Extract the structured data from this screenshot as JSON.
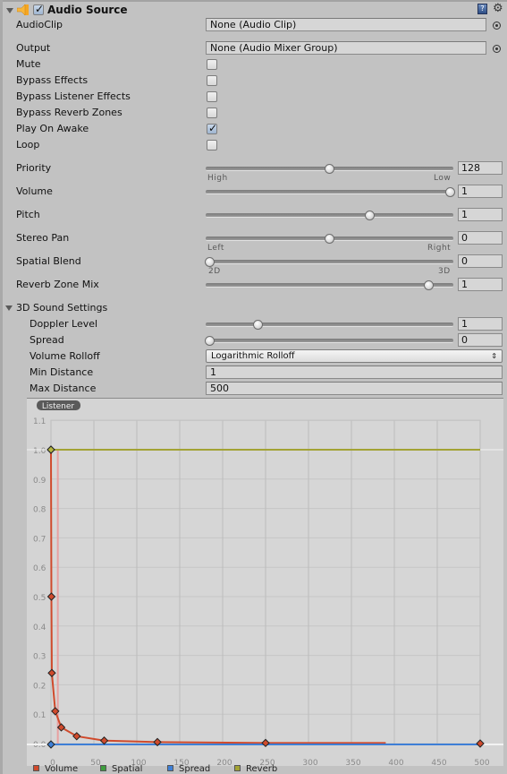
{
  "component": {
    "title": "Audio Source",
    "enabled": true,
    "icons": {
      "component": "audio-source-speaker-icon",
      "help": "help-book-icon",
      "settings": "gear-icon"
    }
  },
  "fields": {
    "audio_clip": {
      "label": "AudioClip",
      "value": "None (Audio Clip)"
    },
    "output": {
      "label": "Output",
      "value": "None (Audio Mixer Group)"
    }
  },
  "toggles": [
    {
      "label": "Mute",
      "checked": false
    },
    {
      "label": "Bypass Effects",
      "checked": false
    },
    {
      "label": "Bypass Listener Effects",
      "checked": false
    },
    {
      "label": "Bypass Reverb Zones",
      "checked": false
    },
    {
      "label": "Play On Awake",
      "checked": true
    },
    {
      "label": "Loop",
      "checked": false
    }
  ],
  "sliders": [
    {
      "label": "Priority",
      "value": "128",
      "fraction": 0.5,
      "min_label": "High",
      "max_label": "Low"
    },
    {
      "label": "Volume",
      "value": "1",
      "fraction": 1.0
    },
    {
      "label": "Pitch",
      "value": "1",
      "fraction": 0.66
    },
    {
      "label": "Stereo Pan",
      "value": "0",
      "fraction": 0.5,
      "min_label": "Left",
      "max_label": "Right"
    },
    {
      "label": "Spatial Blend",
      "value": "0",
      "fraction": 0.0,
      "min_label": "2D",
      "max_label": "3D"
    },
    {
      "label": "Reverb Zone Mix",
      "value": "1",
      "fraction": 0.9
    }
  ],
  "sound3d": {
    "header": "3D Sound Settings",
    "doppler": {
      "label": "Doppler Level",
      "value": "1",
      "fraction": 0.2
    },
    "spread": {
      "label": "Spread",
      "value": "0",
      "fraction": 0.0
    },
    "rolloff": {
      "label": "Volume Rolloff",
      "value": "Logarithmic Rolloff",
      "arrow": "⇕"
    },
    "min_distance": {
      "label": "Min Distance",
      "value": "1"
    },
    "max_distance": {
      "label": "Max Distance",
      "value": "500"
    }
  },
  "chart_data": {
    "type": "line",
    "title": "",
    "badge": "Listener",
    "xlabel": "",
    "ylabel": "",
    "xlim": [
      0,
      500
    ],
    "ylim": [
      0,
      1.1
    ],
    "x_ticks": [
      "0",
      "50",
      "100",
      "150",
      "200",
      "250",
      "300",
      "350",
      "400",
      "450",
      "500"
    ],
    "y_ticks": [
      "0.0",
      "0.1",
      "0.2",
      "0.3",
      "0.4",
      "0.5",
      "0.6",
      "0.7",
      "0.8",
      "0.9",
      "1.0",
      "1.1"
    ],
    "grid": true,
    "listener_x": 8,
    "series": [
      {
        "name": "Volume",
        "color": "#d04a2c",
        "points": [
          [
            0,
            1.0
          ],
          [
            0.5,
            0.5
          ],
          [
            1,
            0.24
          ],
          [
            5,
            0.11
          ],
          [
            12,
            0.055
          ],
          [
            30,
            0.025
          ],
          [
            62,
            0.01
          ],
          [
            124,
            0.005
          ],
          [
            250,
            0.002
          ],
          [
            390,
            0.002
          ]
        ],
        "keys": [
          [
            0,
            1.0
          ],
          [
            0.5,
            0.5
          ],
          [
            1,
            0.24
          ],
          [
            5,
            0.11
          ],
          [
            12,
            0.055
          ],
          [
            30,
            0.025
          ],
          [
            62,
            0.01
          ],
          [
            124,
            0.005
          ],
          [
            250,
            0.002
          ],
          [
            500,
            0.0
          ]
        ]
      },
      {
        "name": "Spatial",
        "color": "#3e9d3e",
        "points": [],
        "keys": []
      },
      {
        "name": "Spread",
        "color": "#3e7fd6",
        "points": [
          [
            0,
            0
          ],
          [
            500,
            0
          ]
        ],
        "keys": [
          [
            0,
            0
          ]
        ]
      },
      {
        "name": "Reverb",
        "color": "#a3a334",
        "points": [
          [
            0,
            1.0
          ],
          [
            500,
            1.0
          ]
        ],
        "keys": [
          [
            0,
            1.0
          ]
        ]
      }
    ],
    "legend": [
      "Volume",
      "Spatial",
      "Spread",
      "Reverb"
    ],
    "legend_position": "bottom-left"
  }
}
